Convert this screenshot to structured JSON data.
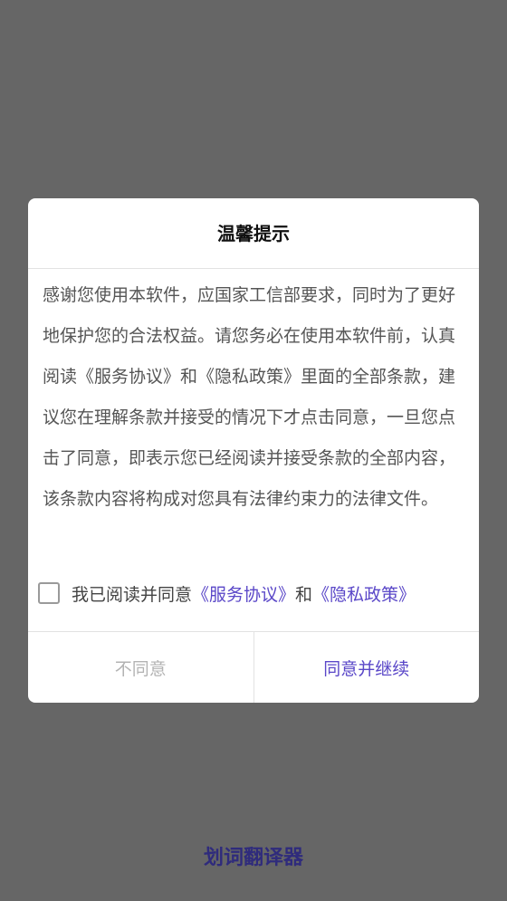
{
  "dialog": {
    "title": "温馨提示",
    "body": "感谢您使用本软件，应国家工信部要求，同时为了更好地保护您的合法权益。请您务必在使用本软件前，认真阅读《服务协议》和《隐私政策》里面的全部条款，建议您在理解条款并接受的情况下才点击同意，一旦您点击了同意，即表示您已经阅读并接受条款的全部内容，该条款内容将构成对您具有法律约束力的法律文件。",
    "agreement": {
      "checked": false,
      "prefix": "我已阅读并同意",
      "service_link": "《服务协议》",
      "connector": "和",
      "privacy_link": "《隐私政策》"
    },
    "buttons": {
      "disagree": "不同意",
      "agree": "同意并继续"
    }
  },
  "app": {
    "name": "划词翻译器"
  },
  "colors": {
    "overlay": "#666666",
    "accent": "#5a47c8",
    "app_name": "#2f2b7c",
    "disabled_text": "#b3b3b3"
  }
}
